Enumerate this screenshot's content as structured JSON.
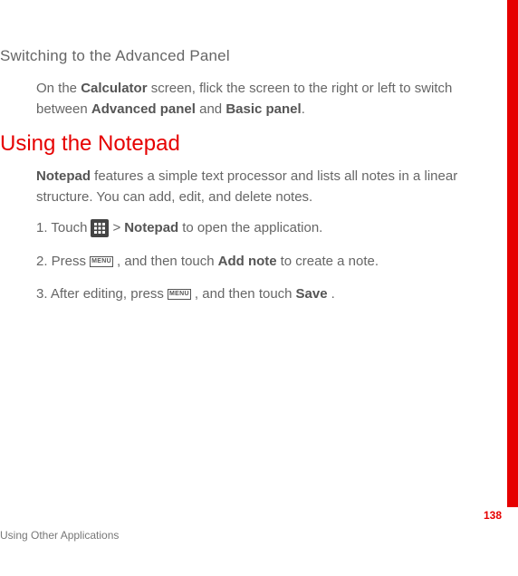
{
  "page": {
    "number": "138",
    "footer": "Using Other Applications"
  },
  "section1": {
    "heading": "Switching to the Advanced Panel",
    "para_pre": "On the ",
    "bold1": "Calculator",
    "para_mid": " screen, flick the screen to the right or left to switch between ",
    "bold2": "Advanced panel",
    "para_mid2": " and ",
    "bold3": "Basic panel",
    "para_end": "."
  },
  "section2": {
    "heading": "Using the Notepad",
    "intro_bold": "Notepad",
    "intro_rest": " features a simple text processor and lists all notes in a linear structure. You can add, edit, and delete notes.",
    "step1_a": "1. Touch ",
    "step1_b": " > ",
    "step1_bold": "Notepad",
    "step1_c": " to open the application.",
    "step2_a": "2. Press ",
    "step2_b": ", and then touch ",
    "step2_bold": "Add note",
    "step2_c": " to create a note.",
    "step3_a": "3. After editing, press ",
    "step3_b": ", and then touch ",
    "step3_bold": "Save",
    "step3_c": "."
  },
  "icons": {
    "menu_label": "MENU"
  }
}
